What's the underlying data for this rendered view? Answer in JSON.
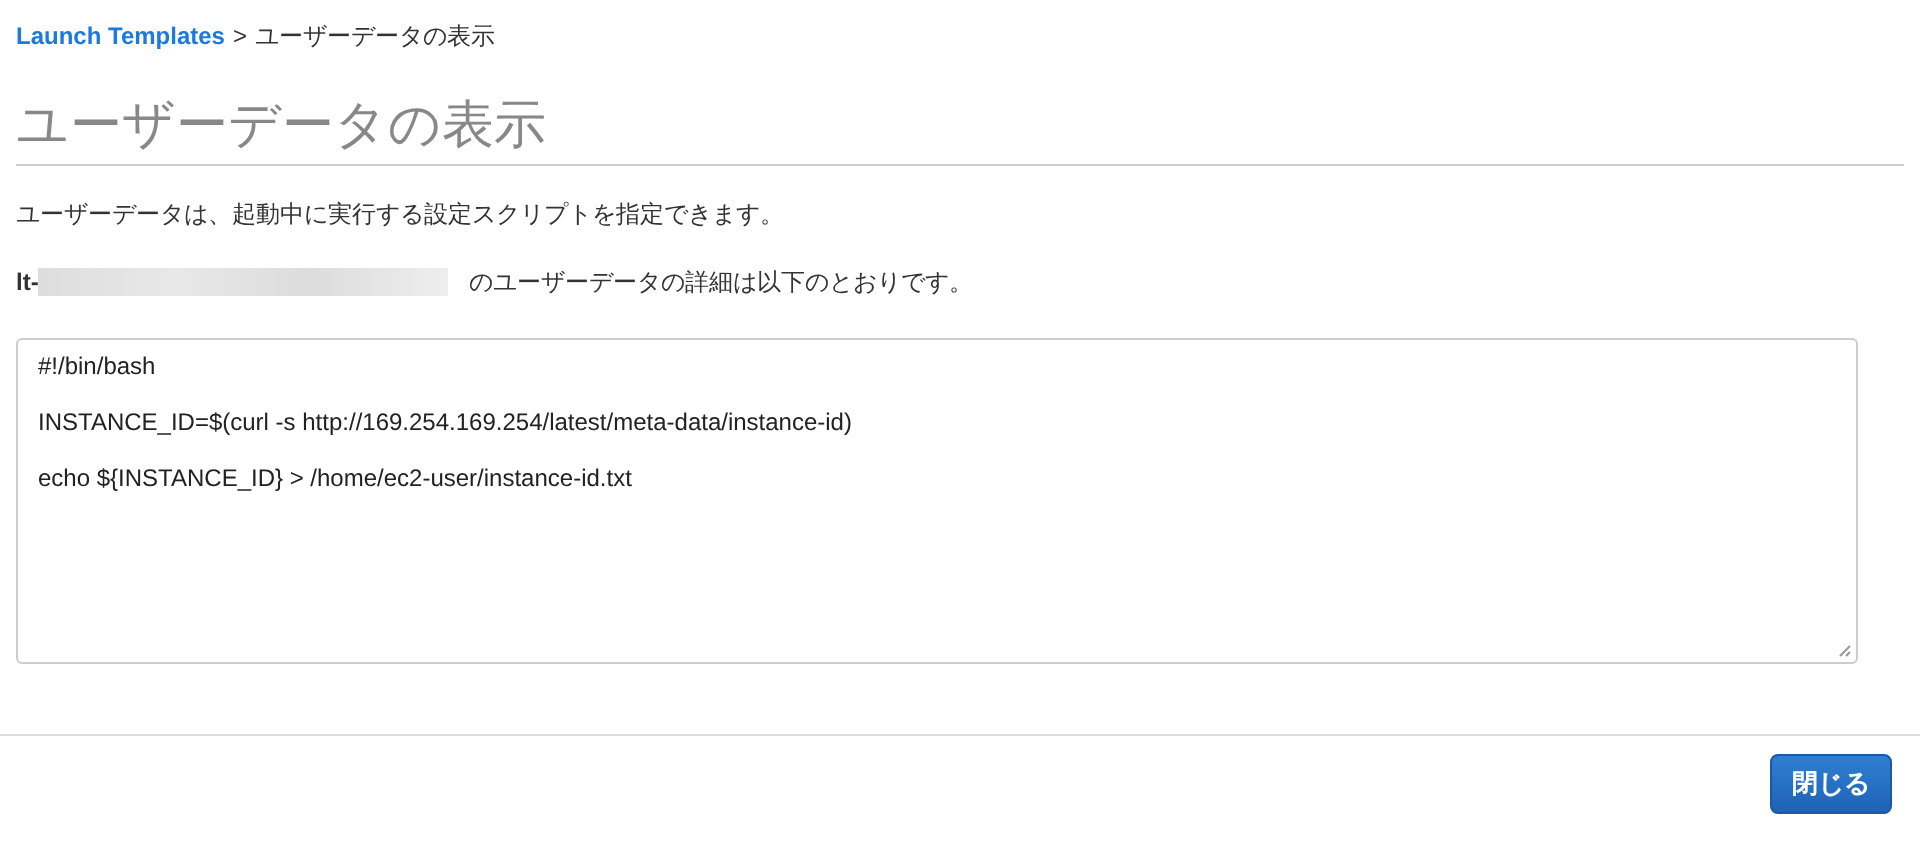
{
  "breadcrumb": {
    "link": "Launch Templates",
    "separator": ">",
    "current": "ユーザーデータの表示"
  },
  "heading": "ユーザーデータの表示",
  "description": "ユーザーデータは、起動中に実行する設定スクリプトを指定できます。",
  "detail": {
    "prefix": "lt-",
    "suffix": "のユーザーデータの詳細は以下のとおりです。"
  },
  "user_data_lines": [
    "#!/bin/bash",
    "INSTANCE_ID=$(curl -s http://169.254.169.254/latest/meta-data/instance-id)",
    "echo ${INSTANCE_ID} > /home/ec2-user/instance-id.txt"
  ],
  "buttons": [
    "閉じる"
  ]
}
